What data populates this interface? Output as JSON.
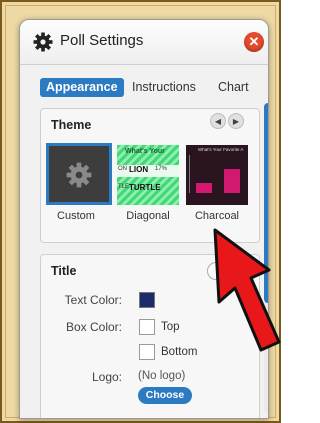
{
  "header": {
    "title": "Poll Settings",
    "icon": "gear-icon",
    "close_icon": "close-icon"
  },
  "tabs": [
    {
      "label": "Appearance",
      "active": true
    },
    {
      "label": "Instructions",
      "active": false
    },
    {
      "label": "Chart",
      "active": false
    }
  ],
  "theme": {
    "heading": "Theme",
    "items": [
      {
        "label": "Custom",
        "selected": true
      },
      {
        "label": "Diagonal",
        "preview_title": "What's Your",
        "preview_row1": "ON",
        "preview_word1": "LION",
        "preview_pct": "17%",
        "preview_row2": "TLE",
        "preview_word2": "TURTLE"
      },
      {
        "label": "Charcoal",
        "preview_title": "What's Your Favorite A"
      }
    ]
  },
  "title_section": {
    "heading": "Title",
    "help_label": "H",
    "text_color_label": "Text Color:",
    "text_color": "#1b2a6b",
    "box_color_label": "Box Color:",
    "top_label": "Top",
    "bottom_label": "Bottom",
    "logo_label": "Logo:",
    "logo_value": "(No logo)",
    "choose_label": "Choose"
  },
  "colors": {
    "accent": "#2c7ac2",
    "close": "#e34b2c",
    "annotation_arrow": "#e8171a"
  }
}
